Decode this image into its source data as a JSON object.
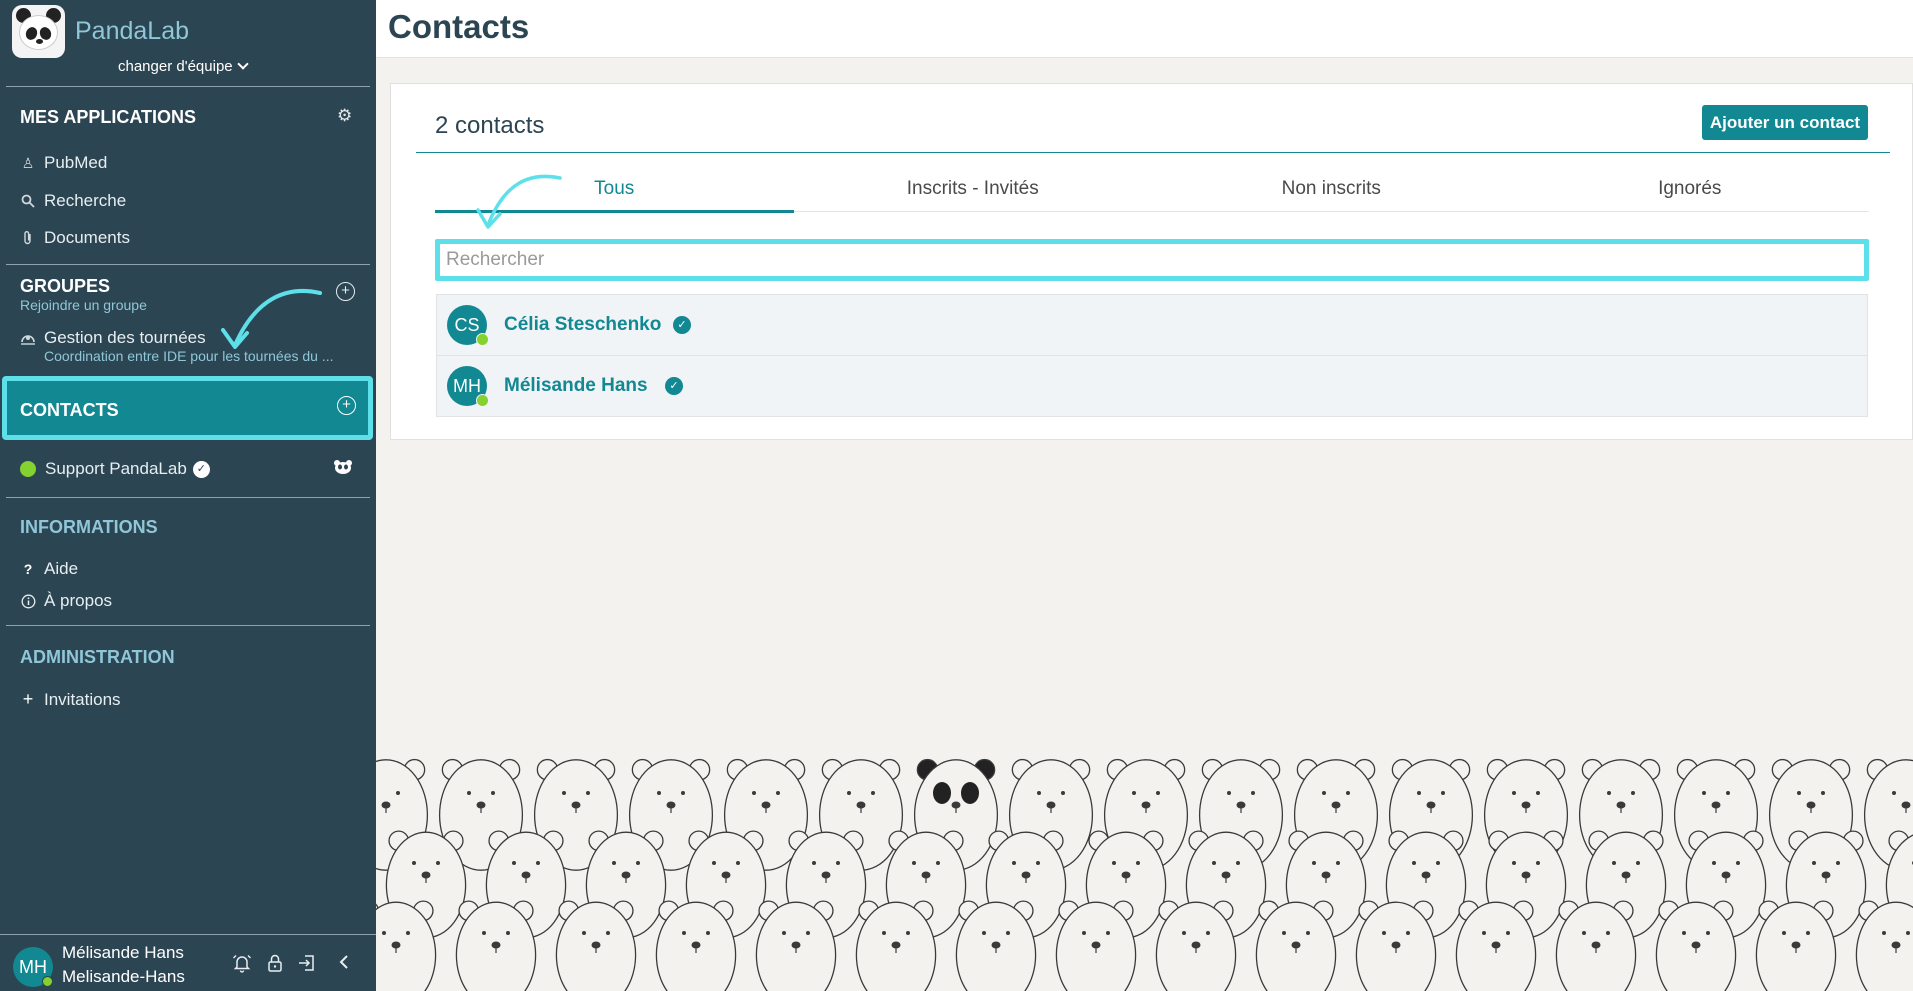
{
  "sidebar": {
    "brand": "PandaLab",
    "team_switch": "changer d'équipe",
    "apps": {
      "title": "MES APPLICATIONS",
      "items": [
        {
          "icon": "pubmed-icon",
          "label": "PubMed"
        },
        {
          "icon": "search-icon",
          "label": "Recherche"
        },
        {
          "icon": "paperclip-icon",
          "label": "Documents"
        }
      ]
    },
    "groups": {
      "title": "GROUPES",
      "subtitle": "Rejoindre un groupe",
      "items": [
        {
          "name": "Gestion des tournées",
          "description": "Coordination entre IDE pour les tournées du ..."
        }
      ]
    },
    "contacts": {
      "title": "CONTACTS",
      "items": [
        {
          "label": "Support PandaLab"
        }
      ]
    },
    "informations": {
      "title": "INFORMATIONS",
      "items": [
        {
          "icon": "question-icon",
          "label": "Aide"
        },
        {
          "icon": "info-icon",
          "label": "À propos"
        }
      ]
    },
    "administration": {
      "title": "ADMINISTRATION",
      "items": [
        {
          "icon": "plus-icon",
          "label": "Invitations"
        }
      ]
    },
    "user": {
      "initials": "MH",
      "name": "Mélisande Hans",
      "handle": "Melisande-Hans"
    }
  },
  "main": {
    "page_title": "Contacts",
    "count_title": "2 contacts",
    "add_button": "Ajouter un contact",
    "tabs": [
      {
        "label": "Tous",
        "active": true
      },
      {
        "label": "Inscrits - Invités",
        "active": false
      },
      {
        "label": "Non inscrits",
        "active": false
      },
      {
        "label": "Ignorés",
        "active": false
      }
    ],
    "search": {
      "placeholder": "Rechercher",
      "value": ""
    },
    "contacts": [
      {
        "initials": "CS",
        "name": "Célia Steschenko",
        "verified": true
      },
      {
        "initials": "MH",
        "name": "Mélisande Hans",
        "verified": true
      }
    ]
  },
  "colors": {
    "sidebar_bg": "#2c4552",
    "accent": "#128892",
    "highlight": "#5de0ea",
    "online": "#84d12f"
  }
}
